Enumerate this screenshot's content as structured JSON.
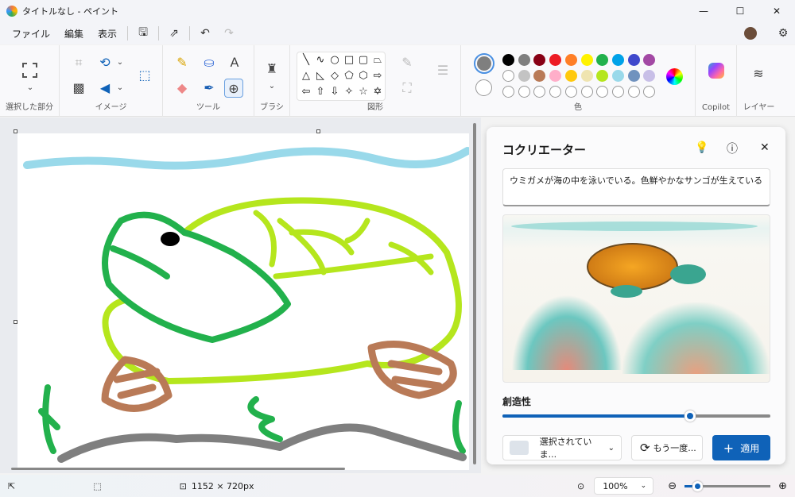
{
  "title": "タイトルなし - ペイント",
  "menu": [
    "ファイル",
    "編集",
    "表示"
  ],
  "ribbon": {
    "groups": {
      "selection": "選択した部分",
      "image": "イメージ",
      "tools": "ツール",
      "brush": "ブラシ",
      "shapes": "図形",
      "colors": "色",
      "copilot": "Copilot",
      "layers": "レイヤー"
    },
    "primary_color": "#7f7f7f",
    "secondary_color": "#ffffff",
    "palette_row1": [
      "#000000",
      "#7f7f7f",
      "#880015",
      "#ed1c24",
      "#ff7f27",
      "#fff200",
      "#22b14c",
      "#00a2e8",
      "#3f48cc",
      "#a349a4"
    ],
    "palette_row2": [
      "#ffffff",
      "#c3c3c3",
      "#b97a57",
      "#ffaec9",
      "#ffc90e",
      "#efe4b0",
      "#b5e61d",
      "#99d9ea",
      "#7092be",
      "#c8bfe7"
    ],
    "shapes": [
      "╲",
      "∿",
      "○",
      "□",
      "▢",
      "⏢",
      "△",
      "◺",
      "◇",
      "⬠",
      "⬡",
      "⇨",
      "⇦",
      "⇧",
      "⇩",
      "✧",
      "☆",
      "✡"
    ]
  },
  "panel": {
    "title": "コクリエーター",
    "prompt": "ウミガメが海の中を泳いでいる。色鮮やかなサンゴが生えている",
    "creativity_label": "創造性",
    "creativity_value": 0.7,
    "style_select": "選択されていま...",
    "retry": "もう一度...",
    "apply": "適用"
  },
  "status": {
    "dimensions": "1152 × 720px",
    "zoom": "100%",
    "zoom_slider": 0.15
  },
  "accent": "#0f62b8"
}
